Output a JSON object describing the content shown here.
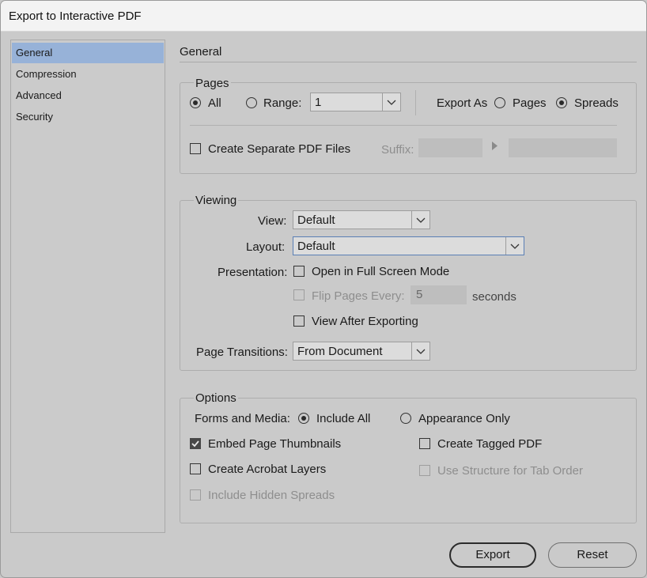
{
  "window": {
    "title": "Export to Interactive PDF"
  },
  "sidebar": {
    "items": [
      {
        "label": "General",
        "selected": true
      },
      {
        "label": "Compression",
        "selected": false
      },
      {
        "label": "Advanced",
        "selected": false
      },
      {
        "label": "Security",
        "selected": false
      }
    ]
  },
  "section_title": "General",
  "pages": {
    "group_label": "Pages",
    "all_label": "All",
    "all_selected": true,
    "range_label": "Range:",
    "range_selected": false,
    "range_value": "1",
    "export_as_label": "Export As",
    "pages_label": "Pages",
    "pages_selected": false,
    "spreads_label": "Spreads",
    "spreads_selected": true,
    "separate_label": "Create Separate PDF Files",
    "separate_checked": false,
    "suffix_label": "Suffix:",
    "suffix_value": "",
    "suffix_preview": ""
  },
  "viewing": {
    "group_label": "Viewing",
    "view_label": "View:",
    "view_value": "Default",
    "layout_label": "Layout:",
    "layout_value": "Default",
    "presentation_label": "Presentation:",
    "full_screen_label": "Open in Full Screen Mode",
    "full_screen_checked": false,
    "flip_label": "Flip Pages Every:",
    "flip_checked": false,
    "flip_value": "5",
    "seconds_label": "seconds",
    "view_after_label": "View After Exporting",
    "view_after_checked": false,
    "transitions_label": "Page Transitions:",
    "transitions_value": "From Document"
  },
  "options": {
    "group_label": "Options",
    "forms_label": "Forms and Media:",
    "include_all_label": "Include All",
    "include_all_selected": true,
    "appearance_label": "Appearance Only",
    "appearance_selected": false,
    "thumbnails_label": "Embed Page Thumbnails",
    "thumbnails_checked": true,
    "tagged_label": "Create Tagged PDF",
    "tagged_checked": false,
    "layers_label": "Create Acrobat Layers",
    "layers_checked": false,
    "structure_label": "Use Structure for Tab Order",
    "structure_checked": false,
    "hidden_label": "Include Hidden Spreads",
    "hidden_checked": false
  },
  "buttons": {
    "export": "Export",
    "reset": "Reset"
  }
}
